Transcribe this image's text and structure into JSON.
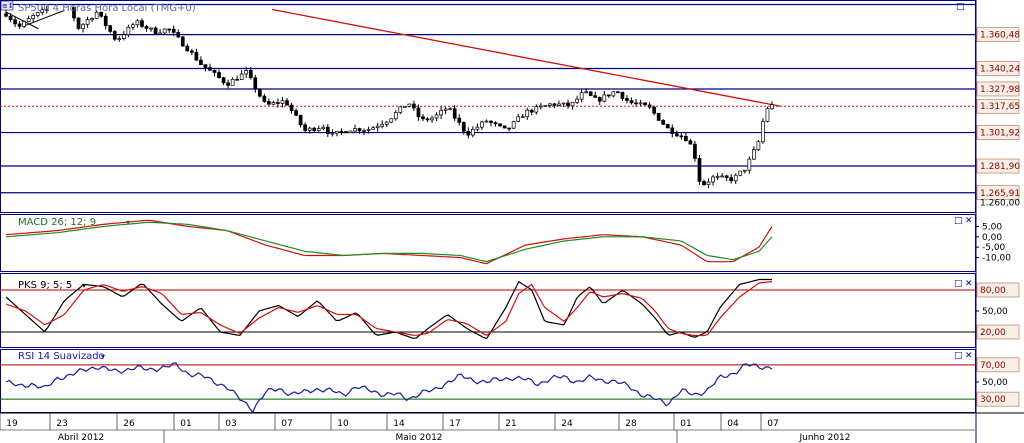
{
  "colors": {
    "background": "#ffffff",
    "hline": "#00008b",
    "trend": "#d01010",
    "bull": "#000000",
    "bear": "#000000",
    "macd_main": "#d01010",
    "macd_signal": "#228b22",
    "pks_k": "#000000",
    "pks_d": "#d01010",
    "rsi": "#1a1aa0",
    "level_text": "#8b0000",
    "level_box": "#f8efe6",
    "ob": "#b00000",
    "os": "#006400"
  },
  "icons": {
    "panel_max": "window-maximize-icon",
    "panel_close": "close-icon",
    "dropdown": "chevron-down-icon",
    "corner": "corner-marker-icon"
  },
  "chart_data": [
    {
      "type": "candlestick",
      "title": "SP500 4 Horas Hora Local (TMG+0)",
      "instrument_label": "SP500",
      "label_prefix": "4 Horas",
      "label_suffix": "Hora Local (TMG+0)",
      "corner_label": "≡↕",
      "ylim": [
        1255,
        1380
      ],
      "ytick_labels": [
        "1.360,48",
        "1.340,24",
        "1.327,98",
        "1.317,65",
        "1.301,92",
        "1.281,90",
        "1.265,91",
        "1.260,00"
      ],
      "ytick_values": [
        1360.48,
        1340.24,
        1327.98,
        1317.65,
        1301.92,
        1281.9,
        1265.91,
        1260.0
      ],
      "horizontal_levels": [
        1378.5,
        1360.48,
        1340.24,
        1327.98,
        1301.92,
        1281.9,
        1265.91
      ],
      "current_level": 1317.65,
      "trendline": [
        {
          "x": 41,
          "y": 1375.5
        },
        {
          "x": 118,
          "y": 1317.7
        }
      ],
      "x_range": [
        0,
        118
      ],
      "anchors": [
        [
          0,
          1373
        ],
        [
          2,
          1365
        ],
        [
          4,
          1371
        ],
        [
          6,
          1375
        ],
        [
          10,
          1377
        ],
        [
          11,
          1364
        ],
        [
          14,
          1374
        ],
        [
          17,
          1357
        ],
        [
          20,
          1368
        ],
        [
          23,
          1362
        ],
        [
          25,
          1364
        ],
        [
          28,
          1352
        ],
        [
          30,
          1343
        ],
        [
          34,
          1331
        ],
        [
          37,
          1338
        ],
        [
          40,
          1318
        ],
        [
          43,
          1321
        ],
        [
          46,
          1303
        ],
        [
          49,
          1306
        ],
        [
          50,
          1300
        ],
        [
          53,
          1304
        ],
        [
          56,
          1304
        ],
        [
          59,
          1310
        ],
        [
          62,
          1320
        ],
        [
          64,
          1309
        ],
        [
          66,
          1311
        ],
        [
          68,
          1317
        ],
        [
          71,
          1301
        ],
        [
          74,
          1309
        ],
        [
          77,
          1303
        ],
        [
          80,
          1314
        ],
        [
          84,
          1319
        ],
        [
          87,
          1318
        ],
        [
          89,
          1326
        ],
        [
          91,
          1321
        ],
        [
          94,
          1327
        ],
        [
          96,
          1320
        ],
        [
          99,
          1317
        ],
        [
          102,
          1304
        ],
        [
          105,
          1298
        ],
        [
          106,
          1290
        ],
        [
          107,
          1270
        ],
        [
          109,
          1275
        ],
        [
          112,
          1274
        ],
        [
          114,
          1281
        ],
        [
          116,
          1297
        ],
        [
          117,
          1316
        ],
        [
          118,
          1318
        ]
      ]
    },
    {
      "type": "line",
      "title": "MACD 26; 12; 9",
      "ylim": [
        -16,
        10
      ],
      "ytick_labels": [
        "5,00",
        "0,00",
        "-5,00",
        "-10,00"
      ],
      "ytick_values": [
        5,
        0,
        -5,
        -10
      ],
      "series": [
        {
          "role": "main",
          "anchors": [
            [
              0,
              1
            ],
            [
              8,
              3
            ],
            [
              15,
              6
            ],
            [
              22,
              8
            ],
            [
              28,
              5
            ],
            [
              34,
              3
            ],
            [
              40,
              -4
            ],
            [
              46,
              -9
            ],
            [
              52,
              -9
            ],
            [
              58,
              -8
            ],
            [
              64,
              -9
            ],
            [
              70,
              -10
            ],
            [
              74,
              -13
            ],
            [
              80,
              -4
            ],
            [
              86,
              -1
            ],
            [
              92,
              1
            ],
            [
              98,
              0
            ],
            [
              104,
              -4
            ],
            [
              108,
              -12
            ],
            [
              112,
              -12
            ],
            [
              116,
              -5
            ],
            [
              118,
              5
            ]
          ]
        },
        {
          "role": "signal",
          "anchors": [
            [
              0,
              0
            ],
            [
              8,
              2
            ],
            [
              15,
              5
            ],
            [
              22,
              7
            ],
            [
              28,
              6
            ],
            [
              34,
              3
            ],
            [
              40,
              -2
            ],
            [
              46,
              -7
            ],
            [
              52,
              -9
            ],
            [
              58,
              -8
            ],
            [
              64,
              -8
            ],
            [
              70,
              -9
            ],
            [
              74,
              -12
            ],
            [
              80,
              -6
            ],
            [
              86,
              -2
            ],
            [
              92,
              0
            ],
            [
              98,
              0
            ],
            [
              104,
              -2
            ],
            [
              108,
              -9
            ],
            [
              112,
              -11
            ],
            [
              116,
              -7
            ],
            [
              118,
              0
            ]
          ]
        }
      ]
    },
    {
      "type": "line",
      "title": "PKS 9; 5; 5",
      "ylim": [
        0,
        100
      ],
      "ytick_labels": [
        "80,00",
        "50,00",
        "20,00"
      ],
      "ytick_values": [
        80,
        50,
        20
      ],
      "reference_levels": {
        "overbought": 80,
        "oversold": 20
      },
      "series": [
        {
          "role": "k",
          "anchors": [
            [
              0,
              70
            ],
            [
              3,
              45
            ],
            [
              6,
              20
            ],
            [
              9,
              65
            ],
            [
              12,
              88
            ],
            [
              15,
              85
            ],
            [
              18,
              70
            ],
            [
              21,
              90
            ],
            [
              24,
              60
            ],
            [
              27,
              35
            ],
            [
              30,
              55
            ],
            [
              33,
              20
            ],
            [
              36,
              15
            ],
            [
              39,
              50
            ],
            [
              42,
              58
            ],
            [
              45,
              42
            ],
            [
              48,
              65
            ],
            [
              51,
              35
            ],
            [
              54,
              48
            ],
            [
              57,
              15
            ],
            [
              60,
              20
            ],
            [
              63,
              10
            ],
            [
              65,
              25
            ],
            [
              68,
              45
            ],
            [
              71,
              25
            ],
            [
              74,
              10
            ],
            [
              77,
              55
            ],
            [
              79,
              92
            ],
            [
              81,
              80
            ],
            [
              83,
              35
            ],
            [
              86,
              30
            ],
            [
              88,
              70
            ],
            [
              90,
              85
            ],
            [
              92,
              60
            ],
            [
              95,
              80
            ],
            [
              98,
              60
            ],
            [
              100,
              40
            ],
            [
              102,
              15
            ],
            [
              104,
              20
            ],
            [
              106,
              12
            ],
            [
              108,
              20
            ],
            [
              110,
              55
            ],
            [
              113,
              88
            ],
            [
              116,
              95
            ],
            [
              118,
              95
            ]
          ]
        },
        {
          "role": "d",
          "anchors": [
            [
              0,
              60
            ],
            [
              3,
              50
            ],
            [
              6,
              30
            ],
            [
              9,
              45
            ],
            [
              12,
              80
            ],
            [
              15,
              88
            ],
            [
              18,
              78
            ],
            [
              21,
              85
            ],
            [
              24,
              75
            ],
            [
              27,
              45
            ],
            [
              30,
              48
            ],
            [
              33,
              30
            ],
            [
              36,
              18
            ],
            [
              39,
              40
            ],
            [
              42,
              55
            ],
            [
              45,
              48
            ],
            [
              48,
              58
            ],
            [
              51,
              45
            ],
            [
              54,
              45
            ],
            [
              57,
              25
            ],
            [
              60,
              20
            ],
            [
              63,
              15
            ],
            [
              65,
              18
            ],
            [
              68,
              38
            ],
            [
              71,
              32
            ],
            [
              74,
              15
            ],
            [
              77,
              35
            ],
            [
              79,
              75
            ],
            [
              81,
              88
            ],
            [
              83,
              55
            ],
            [
              86,
              35
            ],
            [
              88,
              55
            ],
            [
              90,
              78
            ],
            [
              92,
              70
            ],
            [
              95,
              75
            ],
            [
              98,
              68
            ],
            [
              100,
              50
            ],
            [
              102,
              25
            ],
            [
              104,
              18
            ],
            [
              106,
              15
            ],
            [
              108,
              15
            ],
            [
              110,
              40
            ],
            [
              113,
              70
            ],
            [
              116,
              90
            ],
            [
              118,
              92
            ]
          ]
        }
      ]
    },
    {
      "type": "line",
      "title": "RSI 14 Suavizado",
      "ylim": [
        15,
        85
      ],
      "ytick_labels": [
        "70,00",
        "50,00",
        "30,00"
      ],
      "ytick_values": [
        70,
        50,
        30
      ],
      "reference_levels": {
        "overbought": 70,
        "oversold": 30
      },
      "series": [
        {
          "role": "rsi",
          "anchors": [
            [
              0,
              50
            ],
            [
              2,
              45
            ],
            [
              4,
              48
            ],
            [
              6,
              42
            ],
            [
              8,
              55
            ],
            [
              10,
              58
            ],
            [
              12,
              64
            ],
            [
              14,
              68
            ],
            [
              17,
              62
            ],
            [
              20,
              67
            ],
            [
              22,
              64
            ],
            [
              24,
              67
            ],
            [
              26,
              70
            ],
            [
              28,
              60
            ],
            [
              30,
              58
            ],
            [
              32,
              50
            ],
            [
              34,
              45
            ],
            [
              36,
              30
            ],
            [
              38,
              18
            ],
            [
              40,
              38
            ],
            [
              42,
              42
            ],
            [
              44,
              36
            ],
            [
              46,
              38
            ],
            [
              48,
              42
            ],
            [
              50,
              40
            ],
            [
              52,
              35
            ],
            [
              54,
              45
            ],
            [
              56,
              40
            ],
            [
              58,
              36
            ],
            [
              60,
              36
            ],
            [
              62,
              30
            ],
            [
              64,
              38
            ],
            [
              66,
              40
            ],
            [
              68,
              50
            ],
            [
              70,
              57
            ],
            [
              72,
              52
            ],
            [
              74,
              50
            ],
            [
              76,
              53
            ],
            [
              78,
              55
            ],
            [
              80,
              53
            ],
            [
              82,
              48
            ],
            [
              84,
              54
            ],
            [
              86,
              56
            ],
            [
              88,
              50
            ],
            [
              90,
              55
            ],
            [
              92,
              52
            ],
            [
              94,
              50
            ],
            [
              96,
              45
            ],
            [
              98,
              35
            ],
            [
              100,
              30
            ],
            [
              102,
              25
            ],
            [
              104,
              40
            ],
            [
              106,
              35
            ],
            [
              108,
              40
            ],
            [
              110,
              55
            ],
            [
              112,
              60
            ],
            [
              114,
              70
            ],
            [
              116,
              68
            ],
            [
              118,
              67
            ]
          ]
        }
      ]
    }
  ],
  "x_axis": {
    "day_labels": [
      "19",
      "23",
      "26",
      "01",
      "03",
      "07",
      "10",
      "14",
      "17",
      "21",
      "24",
      "28",
      "01",
      "04",
      "07"
    ],
    "month_labels": [
      "Abril 2012",
      "Maio 2012",
      "Junho 2012"
    ]
  }
}
